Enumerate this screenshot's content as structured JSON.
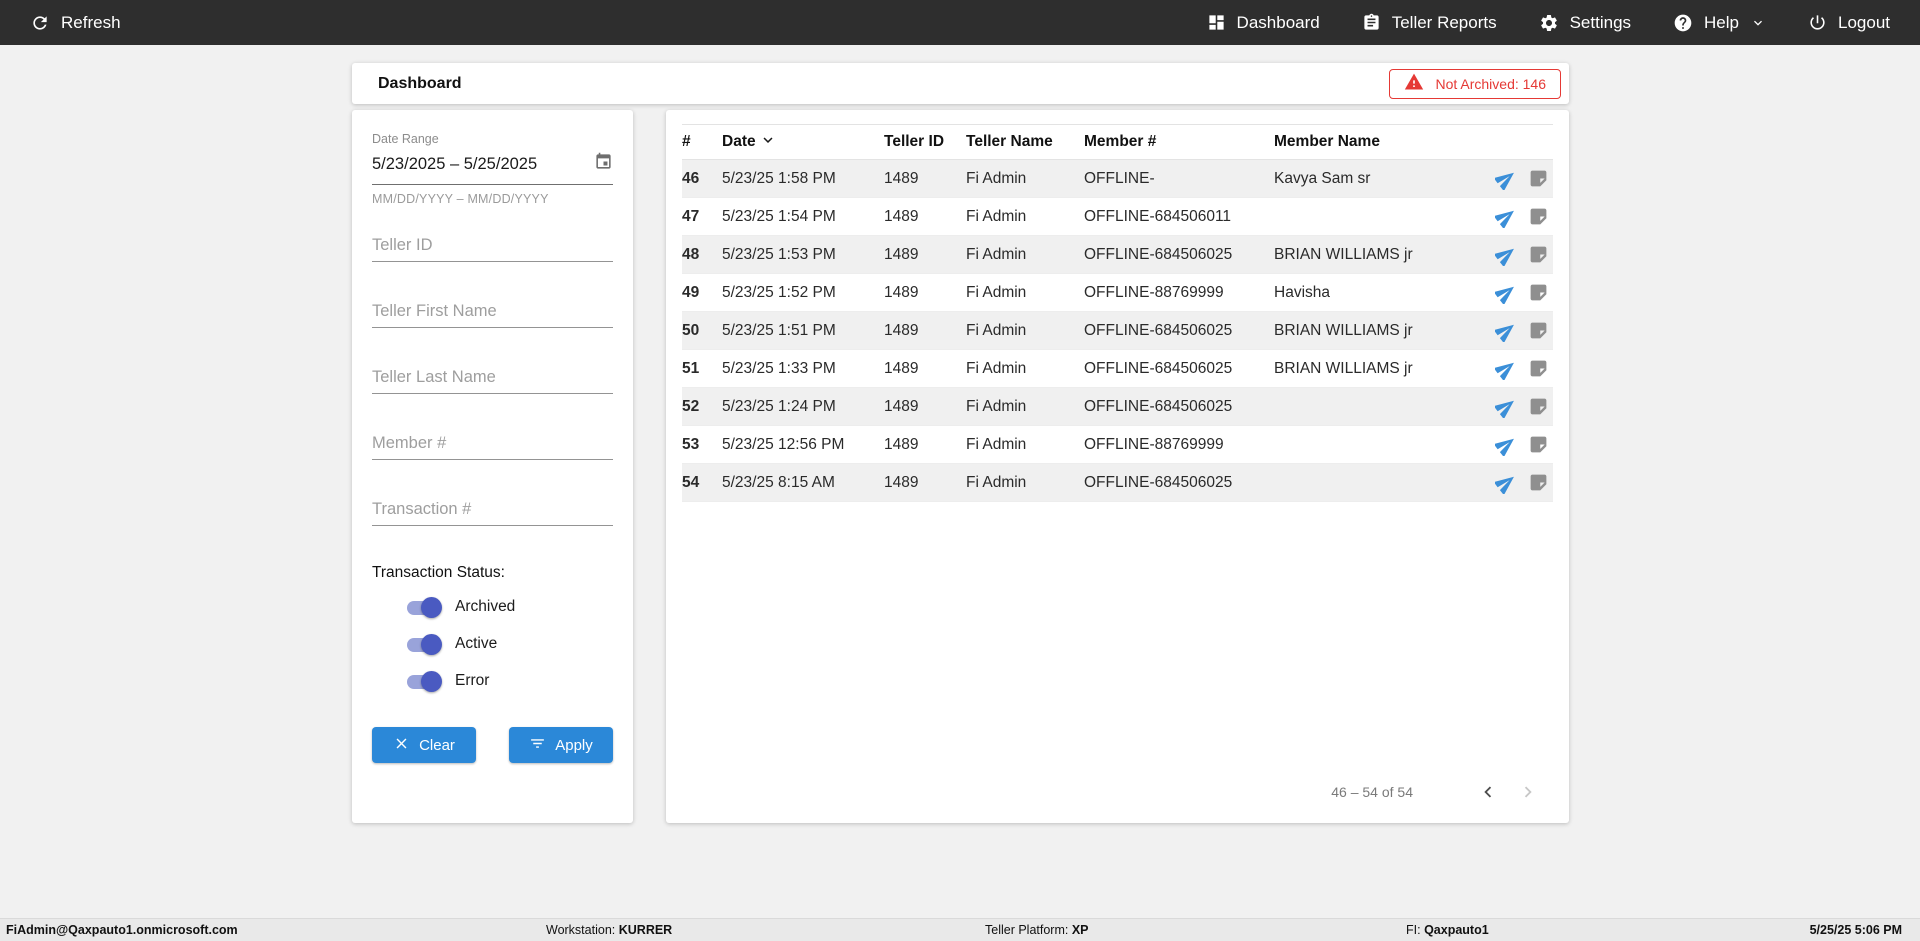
{
  "topnav": {
    "refresh_label": "Refresh",
    "items": [
      {
        "label": "Dashboard",
        "icon": "dashboard-icon"
      },
      {
        "label": "Teller Reports",
        "icon": "reports-icon"
      },
      {
        "label": "Settings",
        "icon": "settings-icon"
      },
      {
        "label": "Help",
        "icon": "help-icon",
        "has_dropdown": true
      },
      {
        "label": "Logout",
        "icon": "logout-icon"
      }
    ]
  },
  "header": {
    "title": "Dashboard",
    "not_archived_badge": "Not Archived: 146"
  },
  "filters": {
    "date_range": {
      "label": "Date Range",
      "value": "5/23/2025 – 5/25/2025",
      "helper": "MM/DD/YYYY – MM/DD/YYYY"
    },
    "text_fields": [
      {
        "placeholder": "Teller ID"
      },
      {
        "placeholder": "Teller First Name"
      },
      {
        "placeholder": "Teller Last Name"
      },
      {
        "placeholder": "Member #"
      },
      {
        "placeholder": "Transaction #"
      }
    ],
    "status": {
      "label": "Transaction Status:",
      "toggles": [
        {
          "label": "Archived",
          "on": true
        },
        {
          "label": "Active",
          "on": true
        },
        {
          "label": "Error",
          "on": true
        }
      ]
    },
    "clear_button": "Clear",
    "apply_button": "Apply"
  },
  "table": {
    "columns": [
      "#",
      "Date",
      "Teller ID",
      "Teller Name",
      "Member #",
      "Member Name"
    ],
    "sorted_column": "Date",
    "sort_direction": "desc",
    "rows": [
      {
        "num": "46",
        "date": "5/23/25 1:58 PM",
        "teller_id": "1489",
        "teller_name": "Fi Admin",
        "member_num": "OFFLINE-",
        "member_name": "Kavya Sam sr"
      },
      {
        "num": "47",
        "date": "5/23/25 1:54 PM",
        "teller_id": "1489",
        "teller_name": "Fi Admin",
        "member_num": "OFFLINE-684506011",
        "member_name": ""
      },
      {
        "num": "48",
        "date": "5/23/25 1:53 PM",
        "teller_id": "1489",
        "teller_name": "Fi Admin",
        "member_num": "OFFLINE-684506025",
        "member_name": "BRIAN WILLIAMS jr"
      },
      {
        "num": "49",
        "date": "5/23/25 1:52 PM",
        "teller_id": "1489",
        "teller_name": "Fi Admin",
        "member_num": "OFFLINE-88769999",
        "member_name": "Havisha"
      },
      {
        "num": "50",
        "date": "5/23/25 1:51 PM",
        "teller_id": "1489",
        "teller_name": "Fi Admin",
        "member_num": "OFFLINE-684506025",
        "member_name": "BRIAN WILLIAMS jr"
      },
      {
        "num": "51",
        "date": "5/23/25 1:33 PM",
        "teller_id": "1489",
        "teller_name": "Fi Admin",
        "member_num": "OFFLINE-684506025",
        "member_name": "BRIAN WILLIAMS jr"
      },
      {
        "num": "52",
        "date": "5/23/25 1:24 PM",
        "teller_id": "1489",
        "teller_name": "Fi Admin",
        "member_num": "OFFLINE-684506025",
        "member_name": ""
      },
      {
        "num": "53",
        "date": "5/23/25 12:56 PM",
        "teller_id": "1489",
        "teller_name": "Fi Admin",
        "member_num": "OFFLINE-88769999",
        "member_name": ""
      },
      {
        "num": "54",
        "date": "5/23/25 8:15 AM",
        "teller_id": "1489",
        "teller_name": "Fi Admin",
        "member_num": "OFFLINE-684506025",
        "member_name": ""
      }
    ],
    "row_action_icons": [
      "send-icon",
      "note-icon"
    ],
    "pagination": {
      "range": "46 – 54 of 54",
      "prev_enabled": true,
      "next_enabled": false
    }
  },
  "statusbar": {
    "user": "FiAdmin@Qaxpauto1.onmicrosoft.com",
    "workstation_label": "Workstation:",
    "workstation": "KURRER",
    "platform_label": "Teller Platform:",
    "platform": "XP",
    "fi_label": "FI:",
    "fi": "Qaxpauto1",
    "datetime": "5/25/25 5:06 PM"
  },
  "colors": {
    "topbar_bg": "#2e2e2e",
    "accent_blue": "#2b88d8",
    "error_red": "#e53935",
    "toggle_on": "#4a5ac1",
    "toggle_track": "#99a3da",
    "send_icon_blue": "#3b8fd8",
    "note_icon_gray": "#8f8f8f",
    "zebra_row": "#f0f0f0"
  }
}
